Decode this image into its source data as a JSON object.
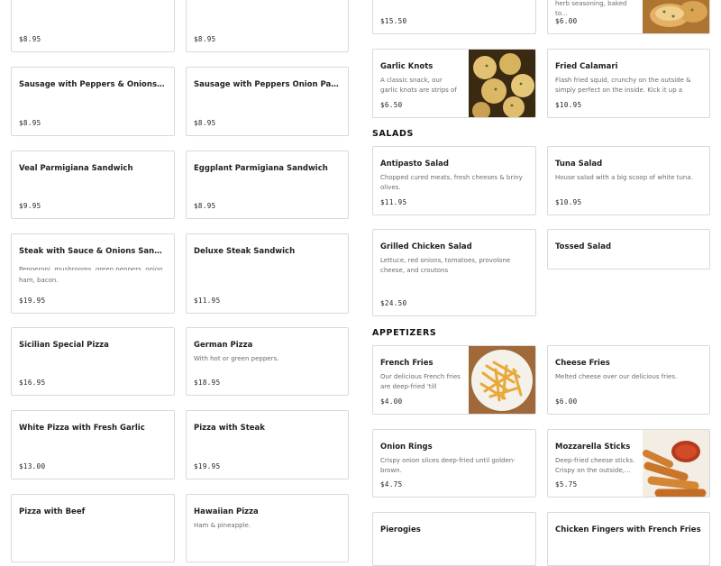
{
  "left_column": [
    {
      "name": "",
      "price": "$8.95"
    },
    {
      "name": "",
      "price": "$8.95"
    },
    {
      "name": "Sausage with Peppers & Onions Sandwich",
      "price": "$8.95"
    },
    {
      "name": "Sausage with Peppers Onion Parm...",
      "price": "$8.95"
    },
    {
      "name": "Veal Parmigiana Sandwich",
      "price": "$9.95"
    },
    {
      "name": "Eggplant Parmigiana Sandwich",
      "price": "$8.95"
    },
    {
      "name": "Steak with Sauce & Onions Sandwich",
      "price": "$19.95",
      "desc": "ham, bacon."
    },
    {
      "name": "Deluxe Steak Sandwich",
      "price": "$11.95"
    },
    {
      "name": "Sicilian Special Pizza",
      "price": "$16.95"
    },
    {
      "name": "German Pizza",
      "desc": "With hot or green peppers.",
      "price": "$18.95"
    },
    {
      "name": "White Pizza with Fresh Garlic",
      "price": "$13.00"
    },
    {
      "name": "Pizza with Steak",
      "price": "$19.95"
    },
    {
      "name": "Pizza with Beef",
      "price": ""
    },
    {
      "name": "Hawaiian Pizza",
      "desc": "Ham & pineapple.",
      "price": ""
    }
  ],
  "top_right": [
    {
      "price": "$15.50"
    },
    {
      "desc": "herb seasoning, baked to...",
      "price": "$6.00",
      "image": "garlic-bread"
    }
  ],
  "right_items": [
    {
      "name": "Garlic Knots",
      "desc": "A classic snack, our garlic knots are strips of pizza...",
      "price": "$6.50",
      "image": "garlic-knots"
    },
    {
      "name": "Fried Calamari",
      "desc": "Flash fried squid, crunchy on the outside & simply perfect on the inside. Kick it up a notch with a...",
      "price": "$10.95"
    }
  ],
  "sections": {
    "salads": "SALADS",
    "appetizers": "APPETIZERS"
  },
  "salads": [
    {
      "name": "Antipasto Salad",
      "desc": "Chopped cured meats, fresh cheeses & briny olives.",
      "price": "$11.95"
    },
    {
      "name": "Tuna Salad",
      "desc": "House salad with a big scoop of white tuna.",
      "price": "$10.95"
    },
    {
      "name": "Grilled Chicken Salad",
      "desc": "Lettuce, red onions, tomatoes, provolone cheese, and croutons",
      "price": "$24.50"
    },
    {
      "name": "Tossed Salad",
      "desc": "",
      "price": ""
    }
  ],
  "appetizers": [
    {
      "name": "French Fries",
      "desc": "Our delicious French fries are deep-fried 'till golden...",
      "price": "$4.00",
      "image": "french-fries"
    },
    {
      "name": "Cheese Fries",
      "desc": "Melted cheese over our delicious fries.",
      "price": "$6.00"
    },
    {
      "name": "Onion Rings",
      "desc": "Crispy onion slices deep-fried until golden-brown.",
      "price": "$4.75"
    },
    {
      "name": "Mozzarella Sticks",
      "desc": "Deep-fried cheese sticks. Crispy on the outside,...",
      "price": "$5.75",
      "image": "mozzarella-sticks"
    },
    {
      "name": "Pierogies",
      "price": ""
    },
    {
      "name": "Chicken Fingers with French Fries",
      "price": ""
    }
  ],
  "steak_overlay_desc": "Pepperoni, mushrooms, green peppers, onion,"
}
